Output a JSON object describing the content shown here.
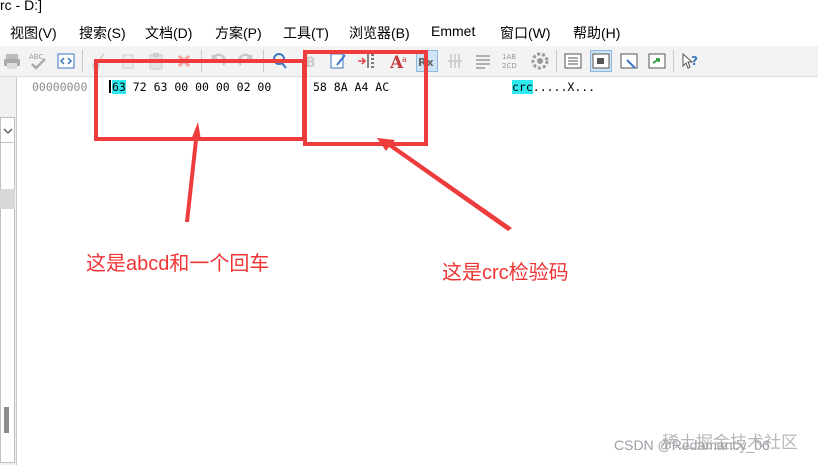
{
  "window": {
    "title_fragment": "rc - D:]"
  },
  "menu": [
    {
      "label": "视图(V)"
    },
    {
      "label": "搜索(S)"
    },
    {
      "label": "文档(D)"
    },
    {
      "label": "方案(P)"
    },
    {
      "label": "工具(T)"
    },
    {
      "label": "浏览器(B)"
    },
    {
      "label": "Emmet"
    },
    {
      "label": "窗口(W)"
    },
    {
      "label": "帮助(H)"
    }
  ],
  "toolbar": {
    "icons": [
      "print-icon",
      "spellcheck-icon",
      "code-icon",
      "cut-icon",
      "copy-icon",
      "paste-icon",
      "delete-icon",
      "undo-icon",
      "redo-icon",
      "search-icon",
      "bold-icon",
      "edit-icon",
      "indent-icon",
      "font-icon",
      "regex-icon",
      "strike-icon",
      "align-icon",
      "abc-icon",
      "settings-icon",
      "view-text-icon",
      "view-hex-icon",
      "view-browser-icon",
      "view-preview-icon",
      "help-icon"
    ]
  },
  "hex": {
    "address": "00000000",
    "bytes_first": "63",
    "bytes_rest": "72 63 00 00 00 02 00",
    "bytes_crc": "58 8A A4 AC",
    "ascii_first": "crc",
    "ascii_rest": ".....X..."
  },
  "annotations": {
    "left": "这是abcd和一个回车",
    "right": "这是crc检验码"
  },
  "watermark": {
    "line": "CSDN @Redamancy_06",
    "overlay": "稀土掘金技术社区"
  },
  "colors": {
    "annotation_red": "#ee3c3c",
    "highlight_cyan": "#2ee8ee"
  }
}
